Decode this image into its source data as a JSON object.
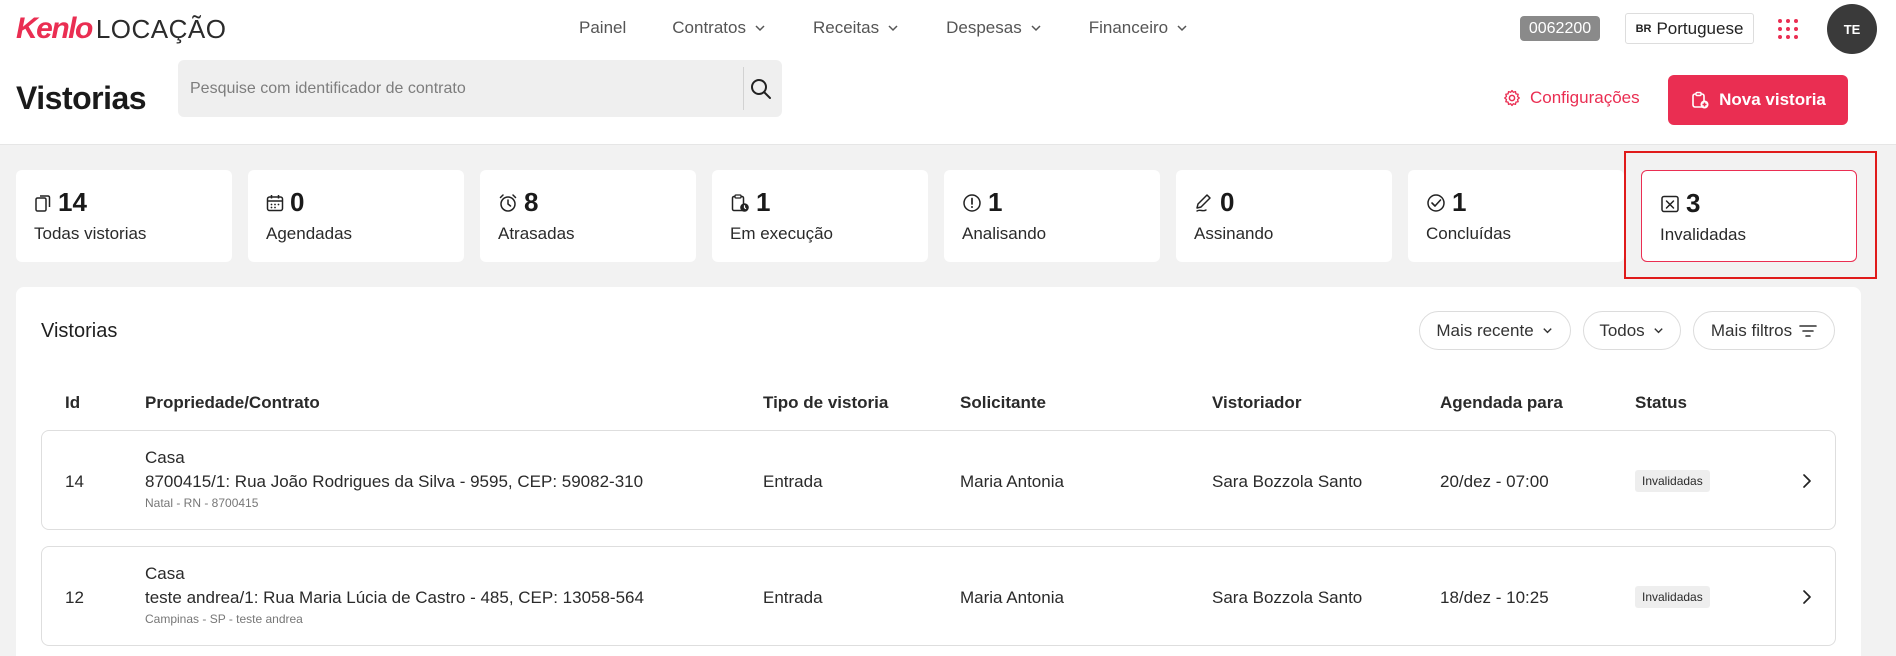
{
  "header": {
    "logo_brand": "Kenlo",
    "logo_suffix": "LOCAÇÃO",
    "nav": [
      {
        "label": "Painel",
        "has_dropdown": false
      },
      {
        "label": "Contratos",
        "has_dropdown": true
      },
      {
        "label": "Receitas",
        "has_dropdown": true
      },
      {
        "label": "Despesas",
        "has_dropdown": true
      },
      {
        "label": "Financeiro",
        "has_dropdown": true
      }
    ],
    "account_code": "0062200",
    "language_flag": "BR",
    "language_label": "Portuguese",
    "apps_icon": "grid-dots-icon",
    "avatar_initials": "TE"
  },
  "page": {
    "title": "Vistorias",
    "search_placeholder": "Pesquise com identificador de contrato",
    "search_value": "",
    "config_label": "Configurações",
    "new_button_label": "Nova vistoria"
  },
  "stats": [
    {
      "count": "14",
      "label": "Todas vistorias",
      "icon": "clipboards-icon"
    },
    {
      "count": "0",
      "label": "Agendadas",
      "icon": "calendar-icon"
    },
    {
      "count": "8",
      "label": "Atrasadas",
      "icon": "alarm-clock-icon"
    },
    {
      "count": "1",
      "label": "Em execução",
      "icon": "clipboard-clock-icon"
    },
    {
      "count": "1",
      "label": "Analisando",
      "icon": "alert-circle-icon"
    },
    {
      "count": "0",
      "label": "Assinando",
      "icon": "pen-icon"
    },
    {
      "count": "1",
      "label": "Concluídas",
      "icon": "check-circle-icon"
    },
    {
      "count": "3",
      "label": "Invalidadas",
      "icon": "x-square-icon",
      "selected": true
    }
  ],
  "table": {
    "title": "Vistorias",
    "filters": {
      "sort_label": "Mais recente",
      "status_label": "Todos",
      "more_label": "Mais filtros"
    },
    "columns": [
      "Id",
      "Propriedade/Contrato",
      "Tipo de vistoria",
      "Solicitante",
      "Vistoriador",
      "Agendada para",
      "Status"
    ],
    "rows": [
      {
        "id": "14",
        "property_type": "Casa",
        "address": "8700415/1: Rua João Rodrigues da Silva - 9595, CEP: 59082-310",
        "location": "Natal - RN - 8700415",
        "type": "Entrada",
        "requester": "Maria Antonia",
        "inspector": "Sara Bozzola Santo",
        "scheduled": "20/dez - 07:00",
        "status": "Invalidadas"
      },
      {
        "id": "12",
        "property_type": "Casa",
        "address": "teste andrea/1: Rua Maria Lúcia de Castro - 485, CEP: 13058-564",
        "location": "Campinas - SP - teste andrea",
        "type": "Entrada",
        "requester": "Maria Antonia",
        "inspector": "Sara Bozzola Santo",
        "scheduled": "18/dez - 10:25",
        "status": "Invalidadas"
      }
    ]
  },
  "colors": {
    "accent": "#ea2e52",
    "highlight_outline": "#e01b1b",
    "background": "#f2f2f2"
  }
}
